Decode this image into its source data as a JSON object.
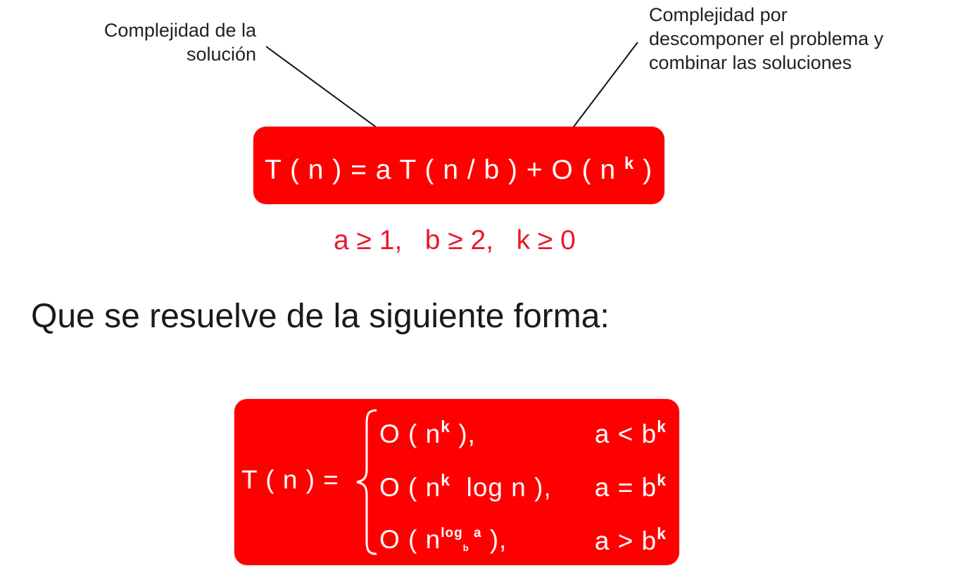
{
  "annotations": {
    "left": {
      "line1": "Complejidad de la",
      "line2": "solución"
    },
    "right": {
      "line1": "Complejidad por",
      "line2": "descomponer el problema y",
      "line3": "combinar las soluciones"
    }
  },
  "recurrence": {
    "main": "T ( n ) = a T ( n / b ) + O ( n ",
    "exponent": "k",
    "close": " )"
  },
  "constraints": "a ≥ 1,   b ≥ 2,   k ≥ 0",
  "intro": "Que se resuelve de la siguiente forma:",
  "solution": {
    "lhs": "T ( n ) =",
    "cases": [
      {
        "expr_pre": "O ( n",
        "expr_sup": "k",
        "expr_post": " ),",
        "cond_pre": "a < b",
        "cond_sup": "k"
      },
      {
        "expr_pre": "O ( n",
        "expr_sup": "k",
        "expr_post": "  log n ),",
        "cond_pre": "a = b",
        "cond_sup": "k"
      },
      {
        "expr_pre": "O ( n",
        "expr_sup_log": "log",
        "expr_sub_base": "b",
        "expr_sup_arg": " a",
        "expr_post": " ),",
        "cond_pre": "a > b",
        "cond_sup": "k"
      }
    ]
  },
  "colors": {
    "box_red": "#ff0000",
    "constraint_red": "#e8192c",
    "text_dark": "#1a1a1a"
  }
}
